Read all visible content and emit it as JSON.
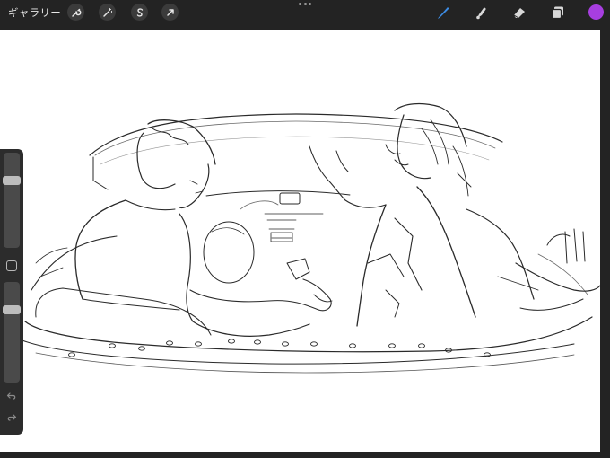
{
  "toolbar": {
    "gallery_label": "ギャラリー",
    "left_tools": [
      {
        "name": "wrench-icon"
      },
      {
        "name": "magic-wand-icon"
      },
      {
        "name": "selection-s-icon"
      },
      {
        "name": "transform-arrow-icon"
      }
    ],
    "right_tools": [
      {
        "name": "brush-icon",
        "active": true
      },
      {
        "name": "smudge-icon",
        "active": false
      },
      {
        "name": "eraser-icon",
        "active": false
      },
      {
        "name": "layers-icon",
        "active": false
      }
    ],
    "current_color": "#a73ee0",
    "active_color": "#3d8de6"
  },
  "sidebar": {
    "brush_size_level": 0.27,
    "opacity_level": 0.25,
    "modify_button": "square-icon",
    "undo": "undo-icon",
    "redo": "redo-icon"
  },
  "canvas": {
    "content": "pencil-sketch-two-figures-in-convertible-car"
  }
}
